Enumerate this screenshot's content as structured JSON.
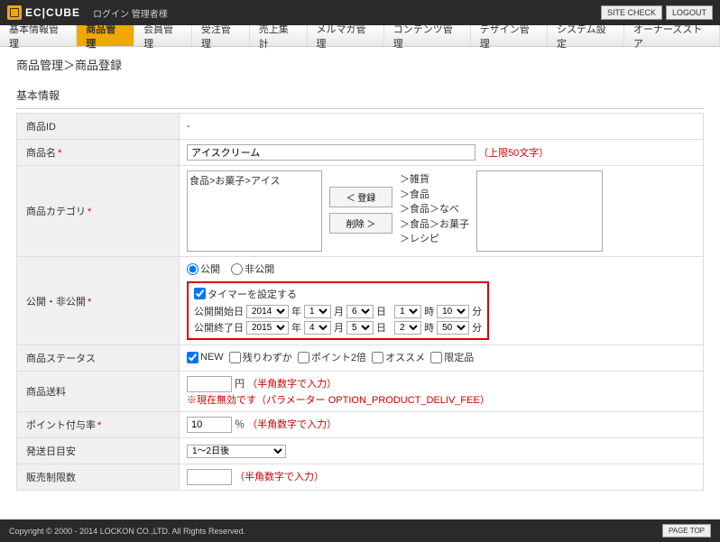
{
  "header": {
    "logo": "EC|CUBE",
    "sub": "ログイン  管理者様",
    "site_check": "SITE CHECK",
    "logout": "LOGOUT"
  },
  "mainnav": [
    "基本情報管理",
    "商品管理",
    "会員管理",
    "受注管理",
    "売上集計",
    "メルマガ管理",
    "コンテンツ管理",
    "デザイン管理",
    "システム設定",
    "オーナーズストア"
  ],
  "breadcrumb": "商品管理＞商品登録",
  "section_basic": "基本情報",
  "rows": {
    "product_id_label": "商品ID",
    "product_id_value": "-",
    "product_name_label": "商品名",
    "product_name_req": "*",
    "product_name_value": "アイスクリーム",
    "product_name_note": "（上限50文字）",
    "category_label": "商品カテゴリ",
    "category_req": "*",
    "category_selected": "食品>お菓子>アイス",
    "category_btn_register": "＜ 登録",
    "category_btn_delete": "削除 ＞",
    "category_tree": [
      "＞雑貨",
      "＞食品",
      "＞食品＞なべ",
      "＞食品＞お菓子",
      "＞レシピ"
    ],
    "publish_label": "公開・非公開",
    "publish_req": "*",
    "publish_public": "公開",
    "publish_private": "非公開",
    "timer_label": "タイマーを設定する",
    "timer_start_label": "公開開始日",
    "timer_end_label": "公開終了日",
    "timer_start": {
      "year": "2014",
      "month": "1",
      "day": "6",
      "hour": "1",
      "min": "10"
    },
    "timer_end": {
      "year": "2015",
      "month": "4",
      "day": "5",
      "hour": "2",
      "min": "50"
    },
    "unit_year": "年",
    "unit_month": "月",
    "unit_day": "日",
    "unit_hour": "時",
    "unit_min": "分",
    "status_label": "商品ステータス",
    "status_opts": {
      "new": "NEW",
      "left": "残りわずか",
      "pt2": "ポイント2倍",
      "rec": "オススメ",
      "ltd": "限定品"
    },
    "shipping_label": "商品送料",
    "shipping_unit": "円",
    "shipping_note": "（半角数字で入力）",
    "shipping_warn": "※現在無効です（パラメーター OPTION_PRODUCT_DELIV_FEE）",
    "point_label": "ポイント付与率",
    "point_req": "*",
    "point_value": "10",
    "point_unit": "％",
    "point_note": "（半角数字で入力）",
    "deliv_label": "発送日目安",
    "deliv_value": "1～2日後",
    "salelimit_label": "販売制限数",
    "salelimit_note": "（半角数字で入力）"
  },
  "footer": {
    "copy": "Copyright © 2000 - 2014 LOCKON CO.,LTD. All Rights Reserved.",
    "pagetop": "PAGE TOP"
  }
}
